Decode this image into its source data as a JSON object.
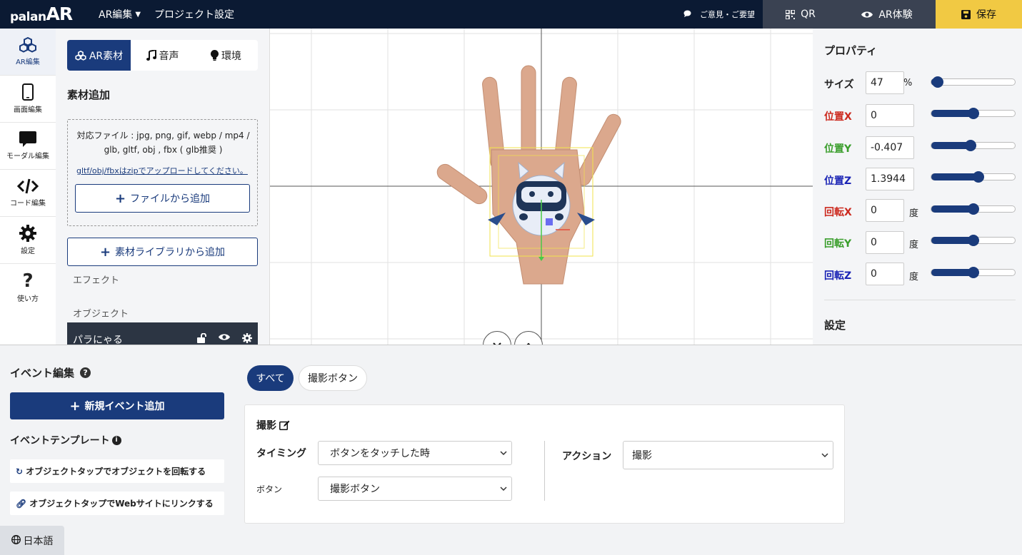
{
  "app": {
    "logo_a": "palan",
    "logo_b": "AR",
    "menu_ar": "AR編集",
    "menu_project": "プロジェクト設定",
    "feedback": "ご意見・ご要望",
    "qr": "QR",
    "experience": "AR体験",
    "save": "保存"
  },
  "leftnav": {
    "items": [
      {
        "label": "AR編集",
        "icon": "cubes-icon"
      },
      {
        "label": "画面編集",
        "icon": "mobile-icon"
      },
      {
        "label": "モーダル編集",
        "icon": "comment-icon"
      },
      {
        "label": "コード編集",
        "icon": "code-icon"
      },
      {
        "label": "設定",
        "icon": "gear-icon"
      },
      {
        "label": "使い方",
        "icon": "question-icon"
      }
    ]
  },
  "leftpanel": {
    "tabs": [
      "AR素材",
      "音声",
      "環境"
    ],
    "section_title": "素材追加",
    "supported": "対応ファイル : jpg, png, gif, webp / mp4 / glb, gltf, obj , fbx ( glb推奨 )",
    "zip_link": "gltf/obj/fbxはzipでアップロードしてください。",
    "add_file": "ファイルから追加",
    "add_library": "素材ライブラリから追加",
    "effects_label": "エフェクト",
    "objects_label": "オブジェクト",
    "object_name": "パラにゃる"
  },
  "props": {
    "title": "プロパティ",
    "settings_title": "設定",
    "rows": [
      {
        "label": "サイズ",
        "value": "47",
        "unit": "%",
        "slider": 0.08,
        "color": "#222222"
      },
      {
        "label": "位置X",
        "value": "0",
        "unit": "",
        "slider": 0.5,
        "color": "#cc2a1f"
      },
      {
        "label": "位置Y",
        "value": "-0.407",
        "unit": "",
        "slider": 0.47,
        "color": "#3a9e2c"
      },
      {
        "label": "位置Z",
        "value": "1.3944",
        "unit": "",
        "slider": 0.56,
        "color": "#1b24b5"
      },
      {
        "label": "回転X",
        "value": "0",
        "unit": "度",
        "slider": 0.5,
        "color": "#cc2a1f"
      },
      {
        "label": "回転Y",
        "value": "0",
        "unit": "度",
        "slider": 0.5,
        "color": "#3a9e2c"
      },
      {
        "label": "回転Z",
        "value": "0",
        "unit": "度",
        "slider": 0.5,
        "color": "#1b24b5"
      }
    ]
  },
  "events": {
    "title": "イベント編集",
    "add_event": "新規イベント追加",
    "templates_title": "イベントテンプレート",
    "templates": [
      "オブジェクトタップでオブジェクトを回転する",
      "オブジェクトタップでWebサイトにリンクする"
    ],
    "filters": [
      "すべて",
      "撮影ボタン"
    ],
    "card": {
      "title": "撮影",
      "timing_label": "タイミング",
      "timing_value": "ボタンをタッチした時",
      "button_label": "ボタン",
      "button_value": "撮影ボタン",
      "action_label": "アクション",
      "action_value": "撮影"
    },
    "language": "日本語"
  },
  "colors": {
    "primary": "#1a3b7c",
    "topbar": "#0b1a33",
    "save": "#f1c943"
  }
}
